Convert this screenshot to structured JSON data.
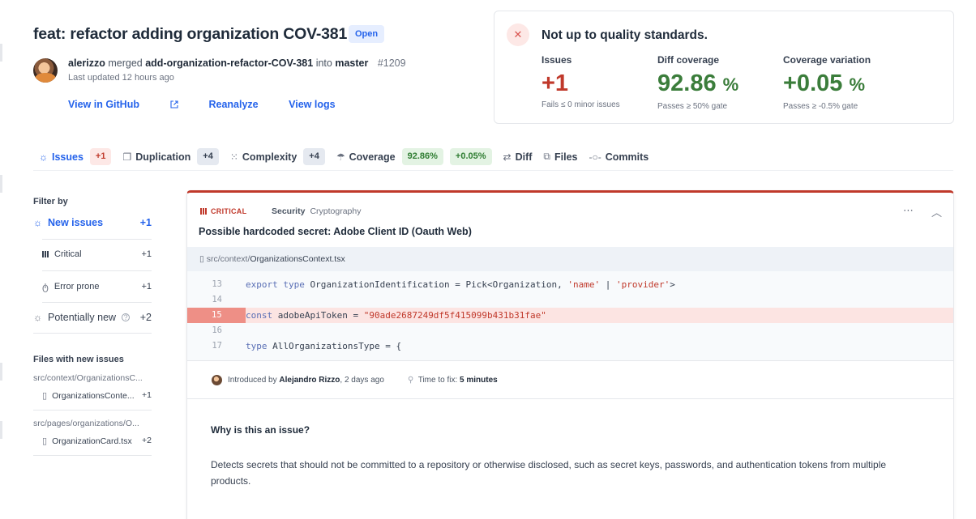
{
  "pr": {
    "title": "feat: refactor adding organization COV-381",
    "status": "Open",
    "author": "alerizzo",
    "merged_text": "merged",
    "source_branch": "add-organization-refactor-COV-381",
    "into_text": "into",
    "target_branch": "master",
    "number": "#1209",
    "updated": "Last updated 12 hours ago",
    "links": [
      "View in GitHub",
      "Reanalyze",
      "View logs"
    ]
  },
  "quality": {
    "headline": "Not up to quality standards.",
    "metrics": [
      {
        "label": "Issues",
        "value": "+1",
        "unit": "",
        "sub": "Fails ≤ 0 minor issues",
        "color": "#c0392b"
      },
      {
        "label": "Diff coverage",
        "value": "92.86",
        "unit": "%",
        "sub": "Passes ≥ 50% gate",
        "color": "#3b7d3b"
      },
      {
        "label": "Coverage variation",
        "value": "+0.05",
        "unit": "%",
        "sub": "Passes ≥ -0.5% gate",
        "color": "#3b7d3b"
      }
    ]
  },
  "tabs": [
    {
      "label": "Issues",
      "badges": [
        "+1"
      ],
      "icon": "bug-icon",
      "active": true
    },
    {
      "label": "Duplication",
      "badges": [
        "+4"
      ],
      "icon": "copy-icon"
    },
    {
      "label": "Complexity",
      "badges": [
        "+4"
      ],
      "icon": "grid-icon"
    },
    {
      "label": "Coverage",
      "badges": [
        "92.86%",
        "+0.05%"
      ],
      "icon": "umbrella-icon"
    },
    {
      "label": "Diff",
      "badges": [],
      "icon": "diff-icon"
    },
    {
      "label": "Files",
      "badges": [],
      "icon": "files-icon"
    },
    {
      "label": "Commits",
      "badges": [],
      "icon": "commit-icon"
    }
  ],
  "sidebar": {
    "filter_label": "Filter by",
    "new_issues": {
      "label": "New issues",
      "count": "+1"
    },
    "critical": {
      "label": "Critical",
      "count": "+1"
    },
    "error_prone": {
      "label": "Error prone",
      "count": "+1"
    },
    "potentially_new": {
      "label": "Potentially new",
      "count": "+2"
    },
    "files_label": "Files with new issues",
    "files": [
      {
        "path": "src/context/OrganizationsC...",
        "name": "OrganizationsConte...",
        "count": "+1"
      },
      {
        "path": "src/pages/organizations/O...",
        "name": "OrganizationCard.tsx",
        "count": "+2"
      }
    ]
  },
  "issue": {
    "severity": "CRITICAL",
    "category": "Security",
    "subcategory": "Cryptography",
    "title": "Possible hardcoded secret: Adobe Client ID (Oauth Web)",
    "file_dir": "src/context/",
    "file_name": "OrganizationsContext.tsx",
    "code": [
      {
        "n": "13",
        "kw": "export type",
        "rest": " OrganizationIdentification = Pick<Organization, ",
        "s1": "'name'",
        "mid": " | ",
        "s2": "'provider'",
        "end": ">"
      },
      {
        "n": "14"
      },
      {
        "n": "15",
        "kw": "const",
        "rest": " adobeApiToken = ",
        "s1": "\"90ade2687249df5f415099b431b31fae\""
      },
      {
        "n": "16"
      },
      {
        "n": "17",
        "kw": "type",
        "rest": " AllOrganizationsType = {"
      }
    ],
    "introduced_prefix": "Introduced by",
    "introduced_by": "Alejandro Rizzo",
    "introduced_when": ", 2 days ago",
    "time_to_fix_prefix": "Time to fix:",
    "time_to_fix": "5 minutes",
    "why_title": "Why is this an issue?",
    "description": "Detects secrets that should not be committed to a repository or otherwise disclosed, such as secret keys, passwords, and authentication tokens from multiple products."
  }
}
